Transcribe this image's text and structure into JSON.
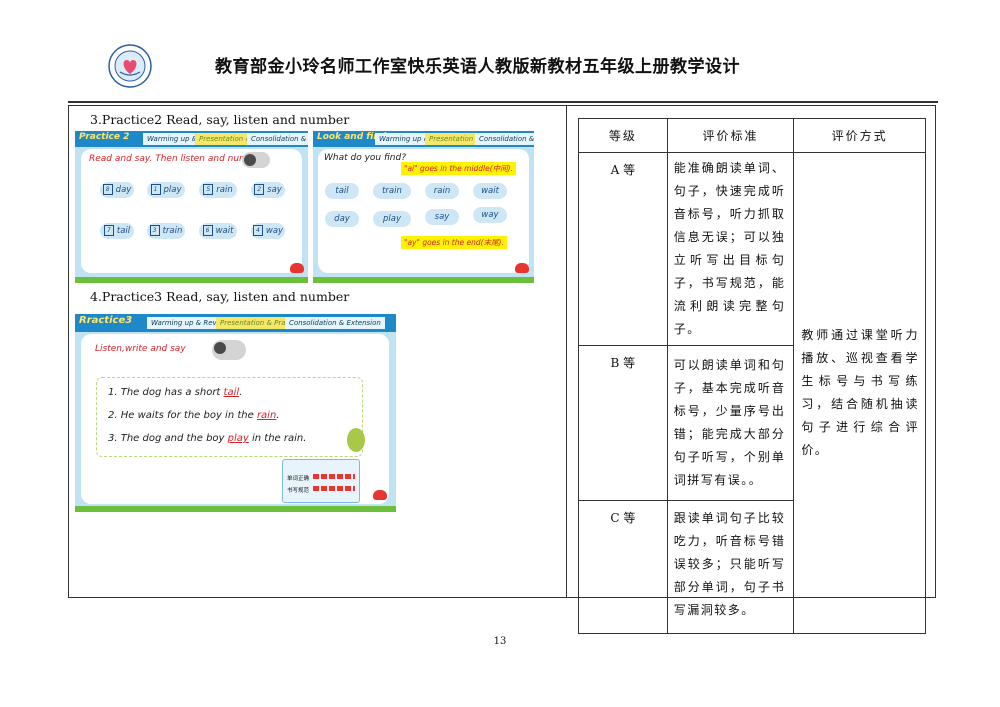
{
  "header": {
    "title": "教育部金小玲名师工作室快乐英语人教版新教材五年级上册教学设计"
  },
  "sections": [
    {
      "label": "3.Practice2 Read, say, listen and number"
    },
    {
      "label": "4.Practice3 Read, say, listen and number"
    }
  ],
  "slide_a": {
    "title": "Practice 2",
    "tabs": [
      "Warming up & Revision",
      "Presentation & Practice",
      "Consolidation & Extension"
    ],
    "instruction": "Read and say. Then listen and number.",
    "words": [
      {
        "num": "8",
        "word": "day"
      },
      {
        "num": "1",
        "word": "play"
      },
      {
        "num": "5",
        "word": "rain"
      },
      {
        "num": "2",
        "word": "say"
      },
      {
        "num": "7",
        "word": "tail"
      },
      {
        "num": "3",
        "word": "train"
      },
      {
        "num": "6",
        "word": "wait"
      },
      {
        "num": "4",
        "word": "way"
      }
    ]
  },
  "slide_b": {
    "title": "Look and find",
    "tabs": [
      "Warming up & Revision",
      "Presentation & Practice",
      "Consolidation & Extension"
    ],
    "question": "What do you find?",
    "note1": "\"ai\" goes in the middle(中间).",
    "note2": "\"ay\" goes in the end(末尾).",
    "ai_words": [
      "tail",
      "train",
      "rain",
      "wait"
    ],
    "ay_words": [
      "day",
      "play",
      "say",
      "way"
    ]
  },
  "slide_c": {
    "title": "Rractice3",
    "tabs": [
      "Warming up & Revision",
      "Presentation & Practice",
      "Consolidation & Extension"
    ],
    "instruction": "Listen,write and say",
    "sentences": [
      {
        "before": "1. The dog has a short ",
        "answer": "tail",
        "after": "."
      },
      {
        "before": "2. He waits for the boy in the ",
        "answer": "rain",
        "after": "."
      },
      {
        "before": "3. The dog and the boy ",
        "answer": "play",
        "after": " in the rain."
      }
    ],
    "score_labels": [
      "单词正确",
      "书写规范"
    ]
  },
  "table": {
    "headers": [
      "等级",
      "评价标准",
      "评价方式"
    ],
    "rows": [
      {
        "grade": "A 等",
        "criteria": "能准确朗读单词、句子，快速完成听音标号，听力抓取信息无误；可以独立听写出目标句子，书写规范，能流利朗读完整句子。"
      },
      {
        "grade": "B 等",
        "criteria": "可以朗读单词和句子，基本完成听音标号，少量序号出错；能完成大部分句子听写，个别单词拼写有误。。"
      },
      {
        "grade": "C 等",
        "criteria": "跟读单词句子比较吃力，听音标号错误较多；只能听写部分单词，句子书写漏洞较多。"
      }
    ],
    "method": "教师通过课堂听力播放、巡视查看学生标号与书写练习，结合随机抽读句子进行综合评价。"
  },
  "footer": {
    "page_number": "13"
  }
}
